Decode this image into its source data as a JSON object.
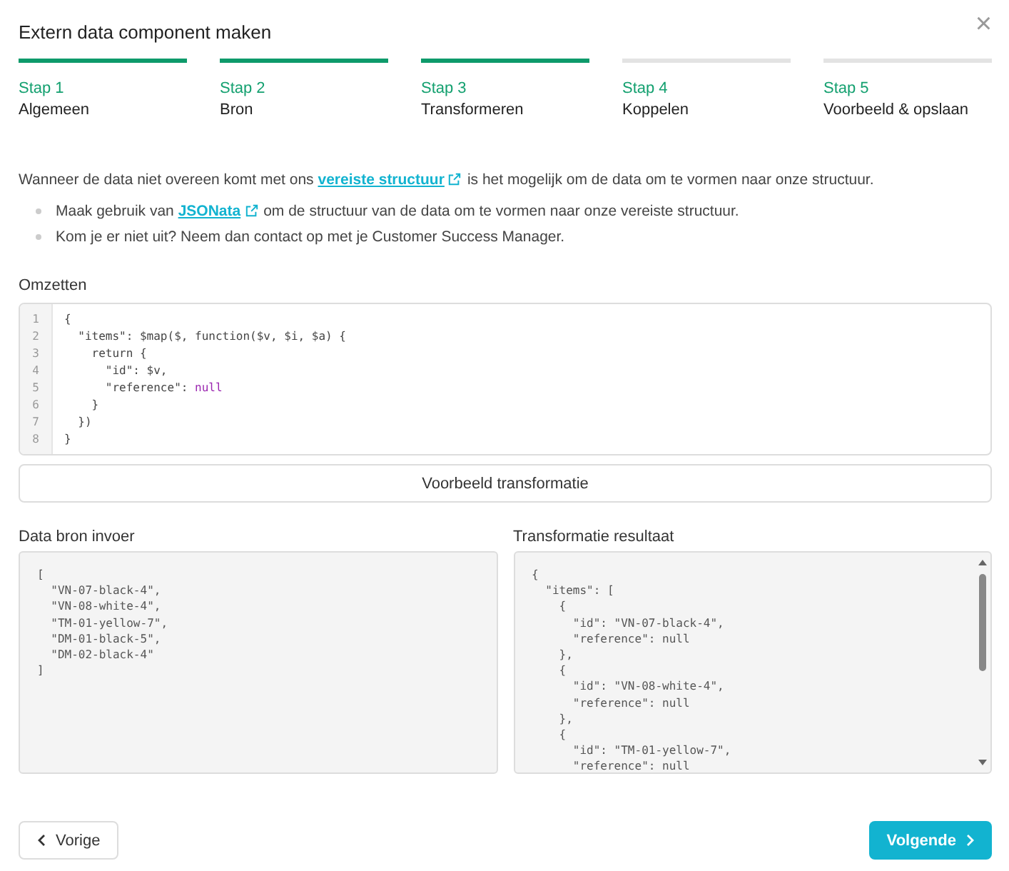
{
  "dialog": {
    "title": "Extern data component maken",
    "close": "×"
  },
  "steps": [
    {
      "number": "Stap 1",
      "label": "Algemeen",
      "done": true
    },
    {
      "number": "Stap 2",
      "label": "Bron",
      "done": true
    },
    {
      "number": "Stap 3",
      "label": "Transformeren",
      "done": true
    },
    {
      "number": "Stap 4",
      "label": "Koppelen",
      "done": false
    },
    {
      "number": "Stap 5",
      "label": "Voorbeeld & opslaan",
      "done": false
    }
  ],
  "intro": {
    "before": "Wanneer de data niet overeen komt met ons",
    "link": "vereiste structuur",
    "after": "is het mogelijk om de data om te vormen naar onze structuur."
  },
  "bullets": [
    {
      "before": "Maak gebruik van",
      "link": "JSONata",
      "after": "om de structuur van de data om te vormen naar onze vereiste structuur."
    },
    {
      "before": "Kom je er niet uit? Neem dan contact op met je Customer Success Manager."
    }
  ],
  "editor": {
    "label": "Omzetten",
    "lines": [
      {
        "number": "1",
        "segments": [
          {
            "text": "{",
            "kind": "plain"
          }
        ]
      },
      {
        "number": "2",
        "segments": [
          {
            "text": "  \"items\": $map($, function($v, $i, $a) {",
            "kind": "plain"
          }
        ]
      },
      {
        "number": "3",
        "segments": [
          {
            "text": "    return {",
            "kind": "plain"
          }
        ]
      },
      {
        "number": "4",
        "segments": [
          {
            "text": "      \"id\": $v,",
            "kind": "plain"
          }
        ]
      },
      {
        "number": "5",
        "segments": [
          {
            "text": "      \"reference\": ",
            "kind": "plain"
          },
          {
            "text": "null",
            "kind": "keyword"
          }
        ]
      },
      {
        "number": "6",
        "segments": [
          {
            "text": "    }",
            "kind": "plain"
          }
        ]
      },
      {
        "number": "7",
        "segments": [
          {
            "text": "  })",
            "kind": "plain"
          }
        ]
      },
      {
        "number": "8",
        "segments": [
          {
            "text": "}",
            "kind": "plain"
          }
        ]
      }
    ]
  },
  "preview_button": "Voorbeeld transformatie",
  "source": {
    "label": "Data bron invoer",
    "lines": [
      "[",
      "  \"VN-07-black-4\",",
      "  \"VN-08-white-4\",",
      "  \"TM-01-yellow-7\",",
      "  \"DM-01-black-5\",",
      "  \"DM-02-black-4\"",
      "]"
    ]
  },
  "result": {
    "label": "Transformatie resultaat",
    "lines": [
      "{",
      "  \"items\": [",
      "    {",
      "      \"id\": \"VN-07-black-4\",",
      "      \"reference\": null",
      "    },",
      "    {",
      "      \"id\": \"VN-08-white-4\",",
      "      \"reference\": null",
      "    },",
      "    {",
      "      \"id\": \"TM-01-yellow-7\",",
      "      \"reference\": null"
    ]
  },
  "footer": {
    "back": "Vorige",
    "next": "Volgende"
  }
}
